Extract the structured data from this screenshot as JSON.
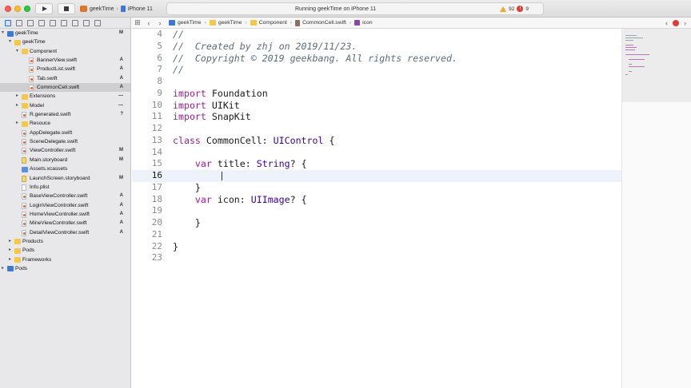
{
  "toolbar": {
    "scheme_project": "geekTime",
    "scheme_device": "iPhone 11",
    "activity_text": "Running geekTime on iPhone 11",
    "warnings": "92",
    "errors": "9"
  },
  "navigator": {
    "items": [
      {
        "label": "geekTime",
        "indent": 0,
        "kind": "project",
        "disclosure": "open",
        "status": "M",
        "selected": false
      },
      {
        "label": "geekTime",
        "indent": 1,
        "kind": "folder",
        "disclosure": "open",
        "status": "",
        "selected": false
      },
      {
        "label": "Component",
        "indent": 2,
        "kind": "folder",
        "disclosure": "open",
        "status": "",
        "selected": false
      },
      {
        "label": "BannerView.swift",
        "indent": 3,
        "kind": "swift",
        "disclosure": "",
        "status": "A",
        "selected": false
      },
      {
        "label": "ProductList.swift",
        "indent": 3,
        "kind": "swift",
        "disclosure": "",
        "status": "A",
        "selected": false
      },
      {
        "label": "Tab.swift",
        "indent": 3,
        "kind": "swift",
        "disclosure": "",
        "status": "A",
        "selected": false
      },
      {
        "label": "CommonCell.swift",
        "indent": 3,
        "kind": "swift",
        "disclosure": "",
        "status": "A",
        "selected": true
      },
      {
        "label": "Extensions",
        "indent": 2,
        "kind": "folder",
        "disclosure": "closed",
        "status": "—",
        "selected": false
      },
      {
        "label": "Model",
        "indent": 2,
        "kind": "folder",
        "disclosure": "closed",
        "status": "—",
        "selected": false
      },
      {
        "label": "R.generated.swift",
        "indent": 2,
        "kind": "swift",
        "disclosure": "",
        "status": "?",
        "selected": false
      },
      {
        "label": "Resouce",
        "indent": 2,
        "kind": "folder",
        "disclosure": "closed",
        "status": "",
        "selected": false
      },
      {
        "label": "AppDelegate.swift",
        "indent": 2,
        "kind": "swift",
        "disclosure": "",
        "status": "",
        "selected": false
      },
      {
        "label": "SceneDelegate.swift",
        "indent": 2,
        "kind": "swift",
        "disclosure": "",
        "status": "",
        "selected": false
      },
      {
        "label": "ViewController.swift",
        "indent": 2,
        "kind": "swift",
        "disclosure": "",
        "status": "M",
        "selected": false
      },
      {
        "label": "Main.storyboard",
        "indent": 2,
        "kind": "story",
        "disclosure": "",
        "status": "M",
        "selected": false
      },
      {
        "label": "Assets.xcassets",
        "indent": 2,
        "kind": "assets",
        "disclosure": "",
        "status": "",
        "selected": false
      },
      {
        "label": "LaunchScreen.storyboard",
        "indent": 2,
        "kind": "story",
        "disclosure": "",
        "status": "M",
        "selected": false
      },
      {
        "label": "Info.plist",
        "indent": 2,
        "kind": "plist",
        "disclosure": "",
        "status": "",
        "selected": false
      },
      {
        "label": "BaseViewController.swift",
        "indent": 2,
        "kind": "swift",
        "disclosure": "",
        "status": "A",
        "selected": false
      },
      {
        "label": "LoginViewController.swift",
        "indent": 2,
        "kind": "swift",
        "disclosure": "",
        "status": "A",
        "selected": false
      },
      {
        "label": "HomeViewController.swift",
        "indent": 2,
        "kind": "swift",
        "disclosure": "",
        "status": "A",
        "selected": false
      },
      {
        "label": "MineViewController.swift",
        "indent": 2,
        "kind": "swift",
        "disclosure": "",
        "status": "A",
        "selected": false
      },
      {
        "label": "DetailViewController.swift",
        "indent": 2,
        "kind": "swift",
        "disclosure": "",
        "status": "A",
        "selected": false
      },
      {
        "label": "Products",
        "indent": 1,
        "kind": "folder",
        "disclosure": "closed",
        "status": "",
        "selected": false
      },
      {
        "label": "Pods",
        "indent": 1,
        "kind": "folder",
        "disclosure": "closed",
        "status": "",
        "selected": false
      },
      {
        "label": "Frameworks",
        "indent": 1,
        "kind": "folder",
        "disclosure": "closed",
        "status": "",
        "selected": false
      },
      {
        "label": "Pods",
        "indent": 0,
        "kind": "project",
        "disclosure": "closed",
        "status": "",
        "selected": false
      }
    ]
  },
  "jumpbar": {
    "items": [
      {
        "label": "geekTime",
        "icon": "proj"
      },
      {
        "label": "geekTime",
        "icon": "fold"
      },
      {
        "label": "Component",
        "icon": "fold"
      },
      {
        "label": "CommonCell.swift",
        "icon": "file"
      },
      {
        "label": "icon",
        "icon": "prop"
      }
    ]
  },
  "editor": {
    "current_line": 16,
    "lines": [
      {
        "n": "4",
        "tokens": [
          [
            "comment",
            "//"
          ]
        ]
      },
      {
        "n": "5",
        "tokens": [
          [
            "comment",
            "//  Created by zhj on 2019/11/23."
          ]
        ]
      },
      {
        "n": "6",
        "tokens": [
          [
            "comment",
            "//  Copyright © 2019 geekbang. All rights reserved."
          ]
        ]
      },
      {
        "n": "7",
        "tokens": [
          [
            "comment",
            "//"
          ]
        ]
      },
      {
        "n": "8",
        "tokens": []
      },
      {
        "n": "9",
        "tokens": [
          [
            "keyword",
            "import"
          ],
          [
            "plain",
            " Foundation"
          ]
        ]
      },
      {
        "n": "10",
        "tokens": [
          [
            "keyword",
            "import"
          ],
          [
            "plain",
            " UIKit"
          ]
        ]
      },
      {
        "n": "11",
        "tokens": [
          [
            "keyword",
            "import"
          ],
          [
            "plain",
            " SnapKit"
          ]
        ]
      },
      {
        "n": "12",
        "tokens": []
      },
      {
        "n": "13",
        "tokens": [
          [
            "keyword",
            "class"
          ],
          [
            "plain",
            " CommonCell: "
          ],
          [
            "type",
            "UIControl"
          ],
          [
            "plain",
            " {"
          ]
        ]
      },
      {
        "n": "14",
        "tokens": []
      },
      {
        "n": "15",
        "tokens": [
          [
            "plain",
            "    "
          ],
          [
            "keyword",
            "var"
          ],
          [
            "plain",
            " title: "
          ],
          [
            "type",
            "String"
          ],
          [
            "plain",
            "? {"
          ]
        ]
      },
      {
        "n": "16",
        "tokens": []
      },
      {
        "n": "17",
        "tokens": [
          [
            "plain",
            "    }"
          ]
        ]
      },
      {
        "n": "18",
        "tokens": [
          [
            "plain",
            "    "
          ],
          [
            "keyword",
            "var"
          ],
          [
            "plain",
            " icon: "
          ],
          [
            "type",
            "UIImage"
          ],
          [
            "plain",
            "? {"
          ]
        ]
      },
      {
        "n": "19",
        "tokens": []
      },
      {
        "n": "20",
        "tokens": [
          [
            "plain",
            "    }"
          ]
        ]
      },
      {
        "n": "21",
        "tokens": []
      },
      {
        "n": "22",
        "tokens": [
          [
            "plain",
            "}"
          ]
        ]
      },
      {
        "n": "23",
        "tokens": []
      }
    ]
  },
  "colors": {
    "keyword": "#9b2393",
    "type": "#3900a0",
    "comment": "#5d6c79",
    "current_line": "#eef3fb"
  }
}
